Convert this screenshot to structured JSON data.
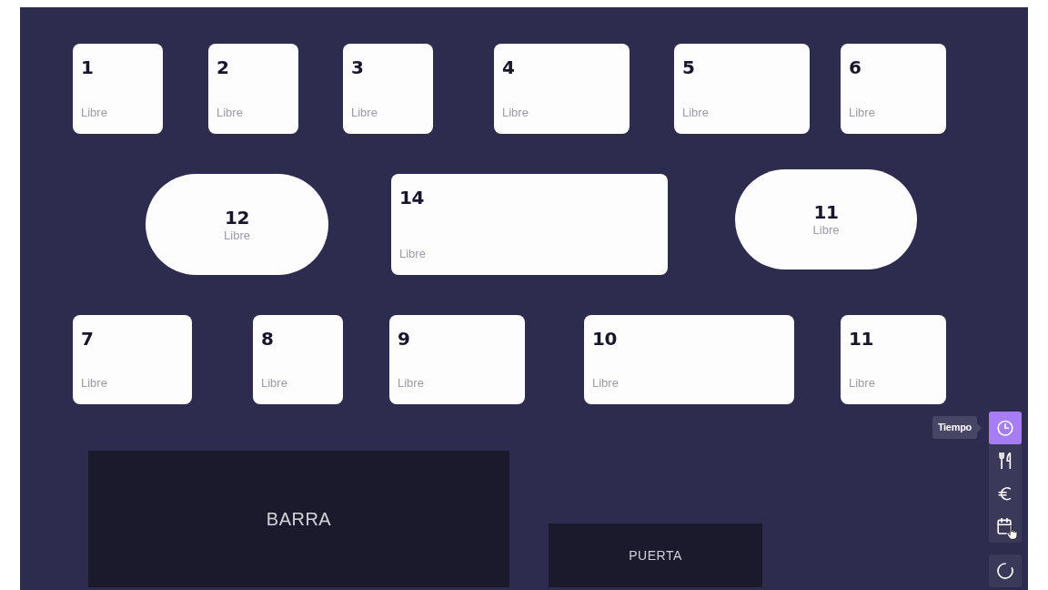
{
  "floor": {
    "tables": [
      {
        "number": "1",
        "status": "Libre",
        "kind": "rect"
      },
      {
        "number": "2",
        "status": "Libre",
        "kind": "rect"
      },
      {
        "number": "3",
        "status": "Libre",
        "kind": "rect"
      },
      {
        "number": "4",
        "status": "Libre",
        "kind": "rect"
      },
      {
        "number": "5",
        "status": "Libre",
        "kind": "rect"
      },
      {
        "number": "6",
        "status": "Libre",
        "kind": "rect"
      },
      {
        "number": "12",
        "status": "Libre",
        "kind": "round"
      },
      {
        "number": "14",
        "status": "Libre",
        "kind": "rect"
      },
      {
        "number": "11",
        "status": "Libre",
        "kind": "round"
      },
      {
        "number": "7",
        "status": "Libre",
        "kind": "rect"
      },
      {
        "number": "8",
        "status": "Libre",
        "kind": "rect"
      },
      {
        "number": "9",
        "status": "Libre",
        "kind": "rect"
      },
      {
        "number": "10",
        "status": "Libre",
        "kind": "rect"
      },
      {
        "number": "11",
        "status": "Libre",
        "kind": "rect"
      }
    ],
    "zones": [
      {
        "label": "BARRA"
      },
      {
        "label": "PUERTA"
      }
    ]
  },
  "toolbar": {
    "tools": [
      {
        "selected": true,
        "hovered": false,
        "tooltip": "Tiempo"
      },
      {
        "selected": false,
        "hovered": false
      },
      {
        "selected": false,
        "hovered": false
      },
      {
        "selected": false,
        "hovered": true
      }
    ]
  }
}
